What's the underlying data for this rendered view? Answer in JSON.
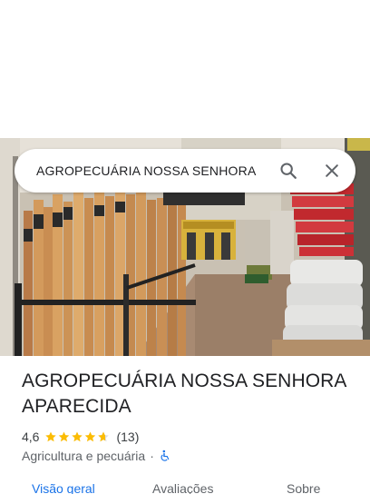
{
  "search": {
    "query": "AGROPECUÁRIA NOSSA SENHORA A"
  },
  "place": {
    "name": "AGROPECUÁRIA NOSSA SENHORA APARECIDA",
    "rating": "4,6",
    "rating_value": 4.6,
    "reviews": "(13)",
    "category": "Agricultura e pecuária",
    "separator": "·",
    "accessibility_icon": "wheelchair-icon"
  },
  "tabs": [
    {
      "label": "Visão geral",
      "active": true
    },
    {
      "label": "Avaliações",
      "active": false
    },
    {
      "label": "Sobre",
      "active": false
    }
  ],
  "colors": {
    "accent": "#1a73e8",
    "star": "#fbbc04",
    "text_primary": "#202124",
    "text_secondary": "#5f6368"
  }
}
